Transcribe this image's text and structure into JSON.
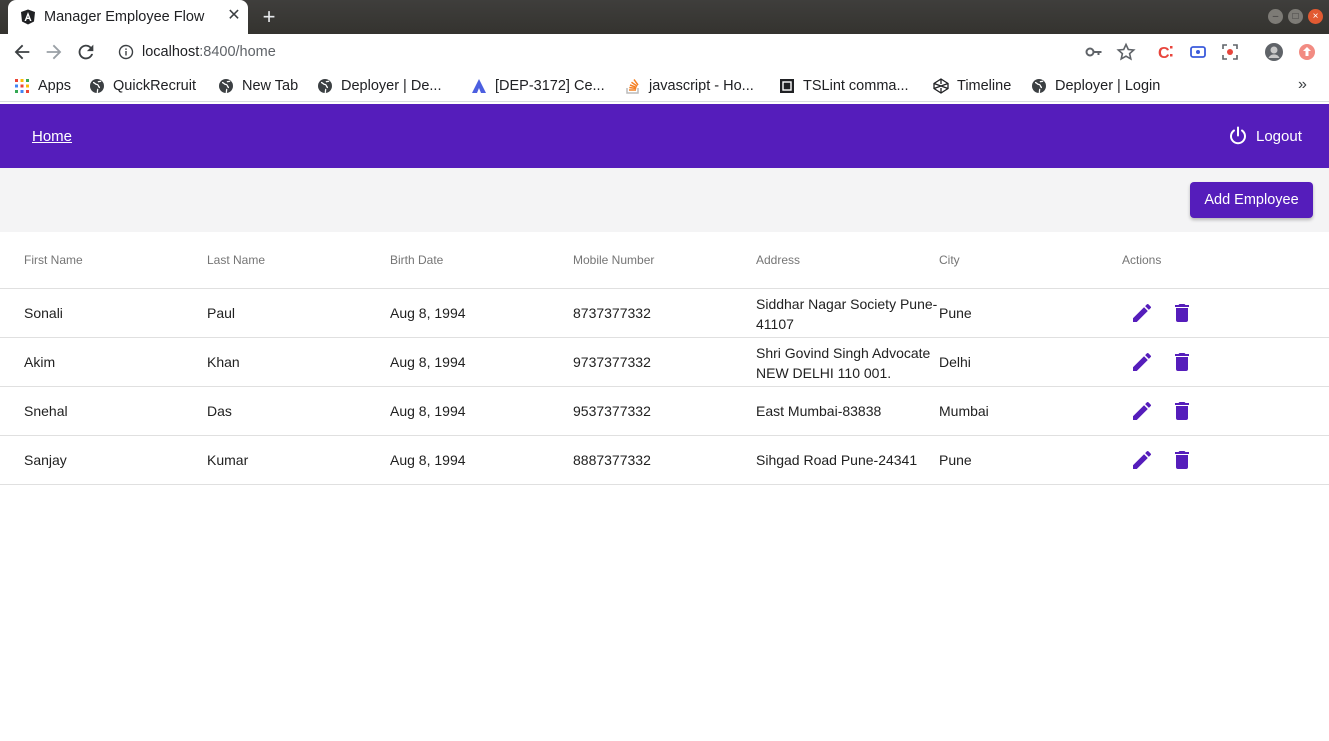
{
  "browser": {
    "tab_title": "Manager Employee Flow",
    "tab_close": "✕",
    "new_tab": "+",
    "url_host": "localhost",
    "url_rest": ":8400/home",
    "bookmarks": [
      {
        "label": "Apps",
        "icon": "apps-grid-icon"
      },
      {
        "label": "QuickRecruit",
        "icon": "globe-icon"
      },
      {
        "label": "New Tab",
        "icon": "globe-icon"
      },
      {
        "label": "Deployer | De...",
        "icon": "globe-icon"
      },
      {
        "label": "[DEP-3172] Ce...",
        "icon": "atlassian-icon"
      },
      {
        "label": "javascript - Ho...",
        "icon": "stackoverflow-icon"
      },
      {
        "label": "TSLint comma...",
        "icon": "tslint-icon"
      },
      {
        "label": "Timeline",
        "icon": "codepen-icon"
      },
      {
        "label": "Deployer | Login",
        "icon": "globe-icon"
      }
    ],
    "bookmarks_more": "»"
  },
  "app": {
    "nav": {
      "home_label": "Home",
      "logout_label": "Logout"
    },
    "add_button_label": "Add Employee",
    "accent_color": "#551dbb",
    "table": {
      "headers": [
        "First Name",
        "Last Name",
        "Birth Date",
        "Mobile Number",
        "Address",
        "City",
        "Actions"
      ],
      "rows": [
        {
          "first": "Sonali",
          "last": "Paul",
          "birth": "Aug 8, 1994",
          "mobile": "8737377332",
          "address": "Siddhar Nagar Society Pune-41107",
          "city": "Pune"
        },
        {
          "first": "Akim",
          "last": "Khan",
          "birth": "Aug 8, 1994",
          "mobile": "9737377332",
          "address": "Shri Govind Singh Advocate NEW DELHI 110 001.",
          "city": "Delhi"
        },
        {
          "first": "Snehal",
          "last": "Das",
          "birth": "Aug 8, 1994",
          "mobile": "9537377332",
          "address": "East Mumbai-83838",
          "city": "Mumbai"
        },
        {
          "first": "Sanjay",
          "last": "Kumar",
          "birth": "Aug 8, 1994",
          "mobile": "8887377332",
          "address": "Sihgad Road Pune-24341",
          "city": "Pune"
        }
      ]
    }
  }
}
